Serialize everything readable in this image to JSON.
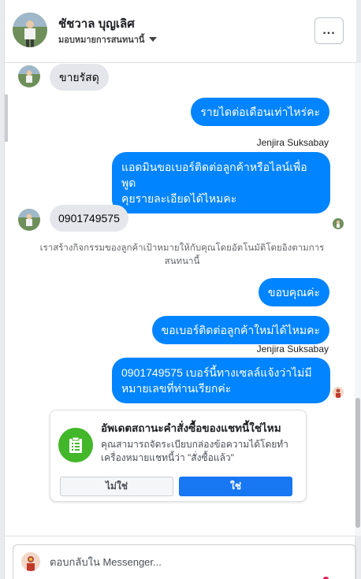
{
  "header": {
    "name": "ชัชวาล บุญเลิศ",
    "subtitle": "มอบหมายการสนทนานี้",
    "more_label": "..."
  },
  "messages": {
    "m1": "ขายรัสดุ",
    "m2": "รายไดต่อเดือนเท่าไหร่คะ",
    "sender1": "Jenjira Suksabay",
    "m3_line1": "แอดมินขอเบอร์ติดต่อลูกค้าหรือไลน์เพื่อพูด",
    "m3_line2": "คุยรายละเอียดได้ไหมคะ",
    "m4": "0901749575",
    "system_line1": "เราสร้างกิจกรรมของลูกค้าเป้าหมายให้กับคุณโดยอัตโนมัติโดยอิงตามการ",
    "system_line2": "สนทนานี้",
    "m5": "ขอบคุณค่ะ",
    "m6": "ขอเบอร์ติดต่อลูกค้าใหม่ได้ไหมคะ",
    "sender2": "Jenjira Suksabay",
    "m7_line1": "0901749575 เบอร์นี้ทางเซลล์แจ้งว่าไม่มี",
    "m7_line2": "หมายเลขที่ท่านเรียกค่ะ"
  },
  "card": {
    "title": "อัพเดตสถานะคำสั่งซื้อของแชทนี้ใช่ไหม",
    "body_line1": "คุณสามารถจัดระเบียบกล่องข้อความได้โดยทำ",
    "body_line2": "เครื่องหมายแชทนี้ว่า \"สั่งซื้อแล้ว\"",
    "no_label": "ไม่ใช่",
    "yes_label": "ใช่",
    "icon": "order-list-icon"
  },
  "composer": {
    "placeholder": "ตอบกลับใน Messenger..."
  },
  "colors": {
    "accent": "#0084ff",
    "incoming": "#e4e6eb",
    "card_icon": "#42b72a",
    "button_primary": "#1877f2"
  }
}
